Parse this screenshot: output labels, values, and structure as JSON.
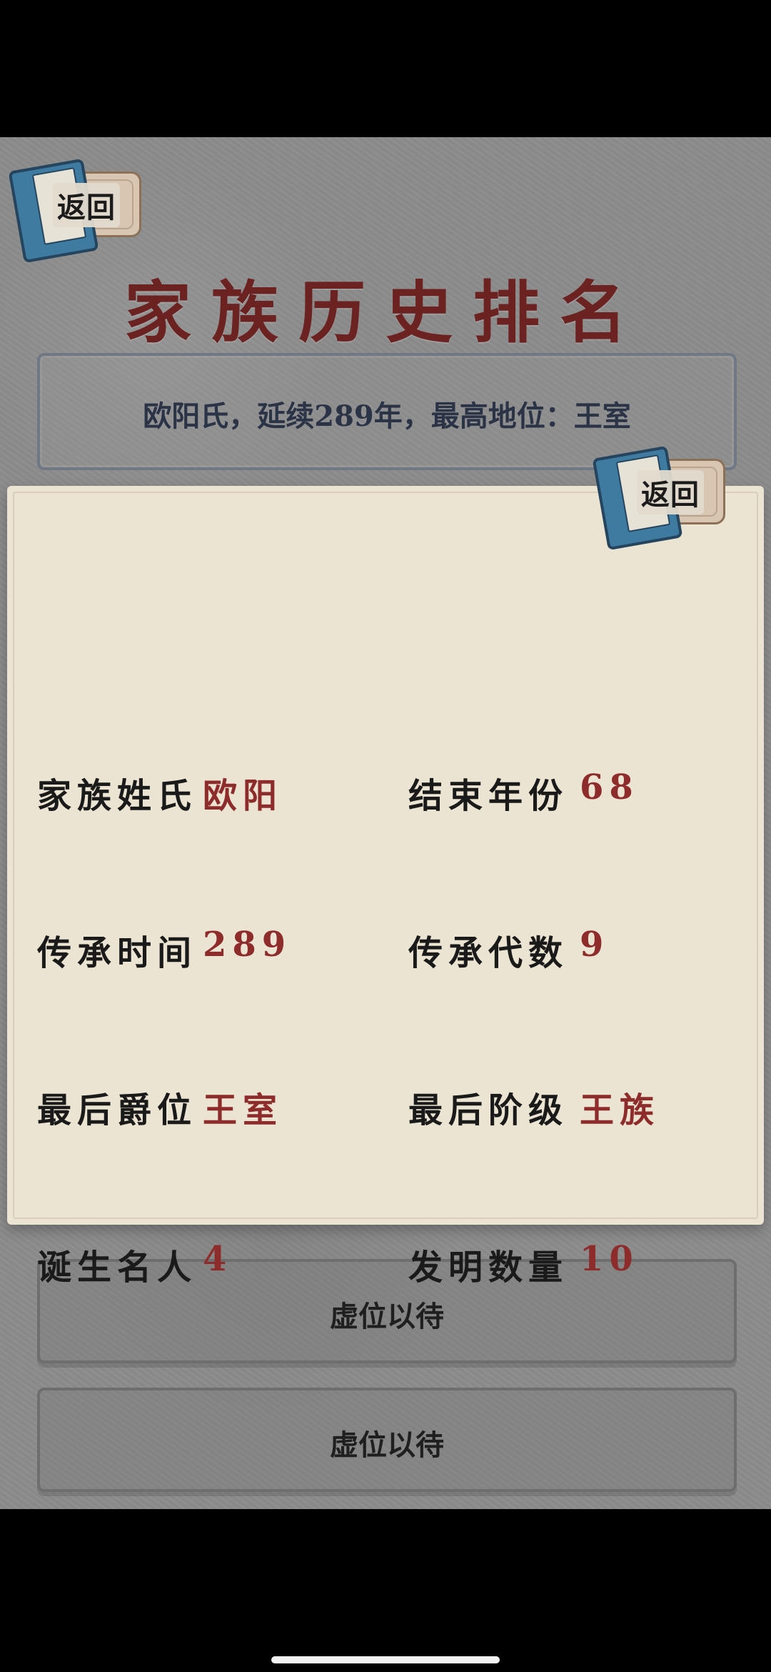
{
  "header": {
    "back_label": "返回",
    "title": "家族历史排名"
  },
  "summary": {
    "text": "欧阳氏，延续289年，最高地位：王室"
  },
  "popup": {
    "back_label": "返回",
    "stats": {
      "surname": {
        "label": "家族姓氏",
        "value": "欧阳"
      },
      "end_year": {
        "label": "结束年份",
        "value": "68"
      },
      "duration": {
        "label": "传承时间",
        "value": "289"
      },
      "generations": {
        "label": "传承代数",
        "value": "9"
      },
      "last_title": {
        "label": "最后爵位",
        "value": "王室"
      },
      "last_class": {
        "label": "最后阶级",
        "value": "王族"
      },
      "famous": {
        "label": "诞生名人",
        "value": "4"
      },
      "inventions": {
        "label": "发明数量",
        "value": "10"
      }
    }
  },
  "slots": [
    {
      "label": "虚位以待"
    },
    {
      "label": "虚位以待"
    }
  ],
  "colors": {
    "title": "#6d2222",
    "value": "#8e2b2b",
    "paper": "#ece4d2",
    "background": "#8c8c8c"
  }
}
